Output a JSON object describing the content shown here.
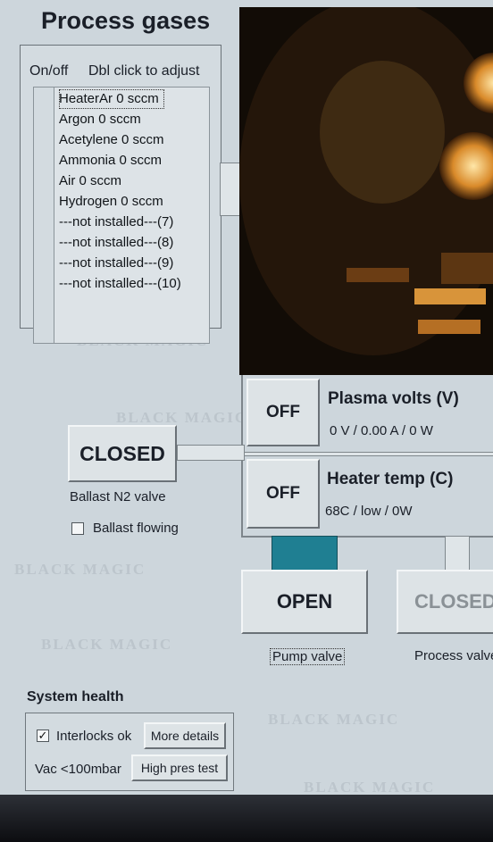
{
  "process_gases": {
    "title": "Process gases",
    "col_onoff": "On/off",
    "col_hint": "Dbl click to adjust",
    "items": [
      {
        "label": "HeaterAr 0 sccm",
        "selected": true
      },
      {
        "label": "Argon 0 sccm"
      },
      {
        "label": "Acetylene 0 sccm"
      },
      {
        "label": "Ammonia 0 sccm"
      },
      {
        "label": "Air 0 sccm"
      },
      {
        "label": "Hydrogen 0 sccm"
      },
      {
        "label": "---not installed---(7)"
      },
      {
        "label": "---not installed---(8)"
      },
      {
        "label": "---not installed---(9)"
      },
      {
        "label": "---not installed---(10)"
      }
    ]
  },
  "watermark_text": "BLACK MAGIC",
  "plasma": {
    "button": "OFF",
    "title": "Plasma volts (V)",
    "readout": "0 V / 0.00 A / 0 W"
  },
  "heater": {
    "button": "OFF",
    "title": "Heater temp (C)",
    "readout": "68C / low / 0W"
  },
  "ballast": {
    "button": "CLOSED",
    "label": "Ballast N2 valve",
    "flowing_label": "Ballast flowing",
    "flowing_checked": false
  },
  "pump_valve": {
    "button": "OPEN",
    "label": "Pump valve"
  },
  "process_valve": {
    "button": "CLOSED",
    "label": "Process valve"
  },
  "system_health": {
    "title": "System health",
    "interlocks_label": "Interlocks ok",
    "interlocks_checked": true,
    "more_details": "More details",
    "vac_label": "Vac <100mbar",
    "high_pres_test": "High pres test"
  },
  "colors": {
    "pipe_active": "#1f7f92",
    "panel_bg": "#cdd6dc"
  }
}
